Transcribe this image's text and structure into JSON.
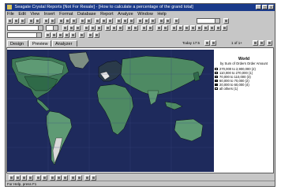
{
  "window": {
    "title": "Seagate Crystal Reports [Not For Resale] - [How to calculate a percentage of the grand total]",
    "minimize_label": "_",
    "maximize_label": "□",
    "close_label": "×"
  },
  "menu": {
    "items": [
      "File",
      "Edit",
      "View",
      "Insert",
      "Format",
      "Database",
      "Report",
      "Analyze",
      "Window",
      "Help"
    ]
  },
  "tabs": [
    "Design",
    "Preview",
    "Analyzer"
  ],
  "nav": {
    "date": "Today 17:5",
    "page": "1 of 1+"
  },
  "legend": {
    "title": "World",
    "subtitle": "by Sum of Orders Order Amount",
    "rows": [
      {
        "label": "270,000 to 2,900,000",
        "count": "(2)",
        "color": "#ffffff"
      },
      {
        "label": "110,000 to 270,000",
        "count": "(1)",
        "color": "#dcdcdc"
      },
      {
        "label": "70,000 to 110,000",
        "count": "(3)",
        "color": "#a8a8a8"
      },
      {
        "label": "60,000 to 70,000",
        "count": "(2)",
        "color": "#6e6e6e"
      },
      {
        "label": "20,000 to 60,000",
        "count": "(4)",
        "color": "#3a3a3a"
      },
      {
        "label": "all others",
        "count": "(1)",
        "color": "#ffffff"
      }
    ]
  },
  "status": {
    "text": "For Help, press F1"
  },
  "colors": {
    "titlebar": "#1a3a8a",
    "chrome": "#c6c6c6",
    "ocean": "#1e2a5c",
    "land": "#4e8a63"
  }
}
